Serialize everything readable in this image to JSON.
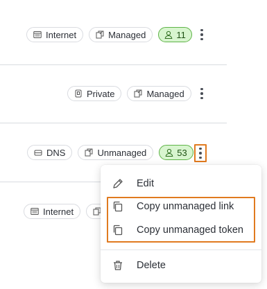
{
  "rows": [
    {
      "tags": [
        {
          "label": "Internet",
          "icon": "browser-window-icon"
        },
        {
          "label": "Managed",
          "icon": "managed-doc-icon"
        }
      ],
      "user_count": "11"
    },
    {
      "tags": [
        {
          "label": "Private",
          "icon": "shield-icon"
        },
        {
          "label": "Managed",
          "icon": "managed-doc-icon"
        }
      ]
    },
    {
      "tags": [
        {
          "label": "DNS",
          "icon": "server-icon"
        },
        {
          "label": "Unmanaged",
          "icon": "unmanaged-doc-icon"
        }
      ],
      "user_count": "53"
    },
    {
      "tags": [
        {
          "label": "Internet",
          "icon": "browser-window-icon"
        }
      ]
    }
  ],
  "menu": {
    "edit": "Edit",
    "copy_link": "Copy unmanaged link",
    "copy_token": "Copy unmanaged token",
    "delete": "Delete"
  },
  "colors": {
    "highlight": "#e07a1f",
    "badge_green_bg": "#d8f5cf",
    "badge_green_border": "#5eb347"
  }
}
